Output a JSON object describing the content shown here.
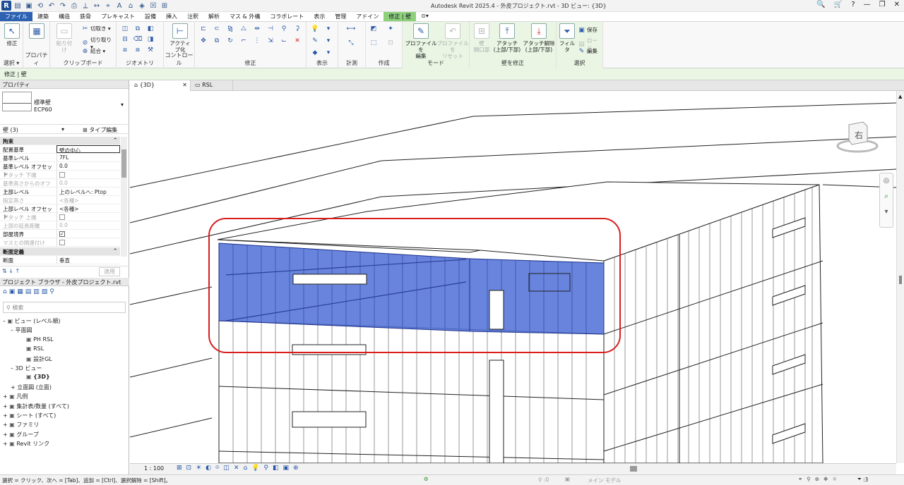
{
  "app": {
    "title": "Autodesk Revit 2025.4 - 外皮プロジェクト.rvt - 3D ビュー: {3D}",
    "logo": "R",
    "quick_access_icons": [
      "open-icon",
      "save-icon",
      "sync-icon",
      "undo-icon",
      "redo-icon",
      "print-icon",
      "measure-icon",
      "dimension-icon",
      "tag-icon",
      "text-icon",
      "3d-view-icon",
      "section-icon",
      "close-hidden-icon",
      "switch-windows-icon"
    ]
  },
  "window_controls": {
    "binoculars": "🔍",
    "cart": "🛒",
    "help": "?",
    "minimize": "—",
    "restore": "❐",
    "close": "✕"
  },
  "menu": {
    "tabs": [
      "ファイル",
      "建築",
      "構造",
      "鉄骨",
      "プレキャスト",
      "設備",
      "挿入",
      "注釈",
      "解析",
      "マス & 外構",
      "コラボレート",
      "表示",
      "管理",
      "アドイン",
      "修正 | 壁"
    ],
    "extra": "⊙▾"
  },
  "ribbon": {
    "modify": {
      "label": "修正",
      "group": "選択 ▾"
    },
    "properties": {
      "label": "プロパティ",
      "group": "プロパティ"
    },
    "clipboard": {
      "paste": "貼り付け",
      "items": [
        "切取き ▾",
        "切り取り ▾",
        "結合 ▾"
      ],
      "group": "クリップボード"
    },
    "geometry": {
      "group": "ジオメトリ"
    },
    "controls": {
      "activate": "アクティブ化",
      "group": "コントロール"
    },
    "modify_group": {
      "group": "修正"
    },
    "view": {
      "group": "表示"
    },
    "measure": {
      "group": "計測"
    },
    "create": {
      "group": "作成"
    },
    "mode": {
      "edit_profile": "プロファイルを\n編集",
      "reset_profile": "プロファイルを\nリセット",
      "group": "モード"
    },
    "wall_modify": {
      "wall_opening": "壁\n開口部",
      "attach": "アタッチ\n(上部/下部)",
      "detach": "アタッチ解除\n(上部/下部)",
      "group": "壁を修正"
    },
    "selection": {
      "filter": "フィルタ",
      "save": "保存",
      "load": "ロード",
      "edit": "編集",
      "group": "選択"
    }
  },
  "options_bar": {
    "text": "修正 | 壁"
  },
  "properties": {
    "header": "プロパティ",
    "type_name": "標準壁",
    "type_sub": "ECP60",
    "instance_filter": "壁 (3)",
    "type_edit": "タイプ編集",
    "section1": "拘束",
    "rows": [
      {
        "k": "配置基準",
        "v": "壁の中心",
        "dim": false
      },
      {
        "k": "基準レベル",
        "v": "7FL",
        "dim": false
      },
      {
        "k": "基準レベル オフセット",
        "v": "0.0",
        "dim": false
      },
      {
        "k": "アタッチ 下端",
        "v": "",
        "dim": true,
        "check": "off"
      },
      {
        "k": "基準高さからのオフセ...",
        "v": "0.0",
        "dim": true
      },
      {
        "k": "上部レベル",
        "v": "上のレベルへ: Ptop",
        "dim": false
      },
      {
        "k": "指定高さ",
        "v": "<各種>",
        "dim": true
      },
      {
        "k": "上部レベル オフセット",
        "v": "<各種>",
        "dim": false
      },
      {
        "k": "アタッチ 上端",
        "v": "",
        "dim": true,
        "check": "off"
      },
      {
        "k": "上部の延長距離",
        "v": "0.0",
        "dim": true
      },
      {
        "k": "部屋境界",
        "v": "",
        "dim": false,
        "check": "on"
      },
      {
        "k": "マスとの関連付け",
        "v": "",
        "dim": true,
        "check": "off"
      }
    ],
    "section2": "断面定義",
    "row_section": {
      "k": "断面",
      "v": "垂直"
    },
    "apply": "適用"
  },
  "browser": {
    "header": "プロジェクト ブラウザ - 外皮プロジェクト.rvt",
    "search_placeholder": "検索",
    "items": [
      {
        "label": "ビュー (レベル順)",
        "indent": 0,
        "prefix": "–"
      },
      {
        "label": "平面図",
        "indent": 1,
        "prefix": "–"
      },
      {
        "label": "PH RSL",
        "indent": 3,
        "prefix": ""
      },
      {
        "label": "RSL",
        "indent": 3,
        "prefix": ""
      },
      {
        "label": "設計GL",
        "indent": 3,
        "prefix": ""
      },
      {
        "label": "3D ビュー",
        "indent": 1,
        "prefix": "–"
      },
      {
        "label": "{3D}",
        "indent": 3,
        "prefix": "",
        "bold": true
      },
      {
        "label": "立面図 (立面)",
        "indent": 1,
        "prefix": "+"
      },
      {
        "label": "凡例",
        "indent": 0,
        "prefix": "+"
      },
      {
        "label": "集計表/数量 (すべて)",
        "indent": 0,
        "prefix": "+"
      },
      {
        "label": "シート (すべて)",
        "indent": 0,
        "prefix": "+"
      },
      {
        "label": "ファミリ",
        "indent": 0,
        "prefix": "+"
      },
      {
        "label": "グループ",
        "indent": 0,
        "prefix": "+"
      },
      {
        "label": "Revit リンク",
        "indent": 0,
        "prefix": "+"
      }
    ]
  },
  "view_tabs": [
    {
      "label": "{3D}",
      "active": true
    },
    {
      "label": "RSL",
      "active": false
    }
  ],
  "viewcube": {
    "face": "右"
  },
  "view_control_bar": {
    "scale": "1 : 100"
  },
  "status": {
    "hint": "選択 = クリック、次へ = [Tab]、追加 = [Ctrl]、選択解除 = [Shift]。",
    "worksharing": ":0",
    "model": "メイン モデル",
    "filter_count": ":3"
  }
}
